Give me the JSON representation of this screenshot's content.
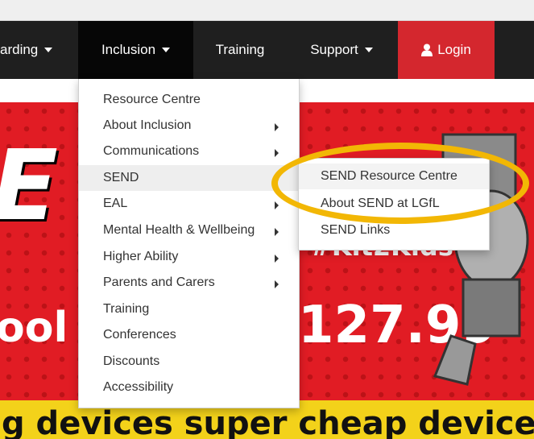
{
  "nav": {
    "safeguarding_label": "arding",
    "inclusion_label": "Inclusion",
    "training_label": "Training",
    "support_label": "Support",
    "login_label": "Login",
    "login_color": "#d4272e"
  },
  "dropdown": {
    "items": [
      {
        "label": "Resource Centre",
        "has_submenu": false
      },
      {
        "label": "About Inclusion",
        "has_submenu": true
      },
      {
        "label": "Communications",
        "has_submenu": true
      },
      {
        "label": "SEND",
        "has_submenu": true
      },
      {
        "label": "EAL",
        "has_submenu": true
      },
      {
        "label": "Mental Health & Wellbeing",
        "has_submenu": true
      },
      {
        "label": "Higher Ability",
        "has_submenu": true
      },
      {
        "label": "Parents and Carers",
        "has_submenu": true
      },
      {
        "label": "Training",
        "has_submenu": false
      },
      {
        "label": "Conferences",
        "has_submenu": false
      },
      {
        "label": "Discounts",
        "has_submenu": false
      },
      {
        "label": "Accessibility",
        "has_submenu": false
      }
    ]
  },
  "submenu": {
    "items": [
      {
        "label": "SEND Resource Centre"
      },
      {
        "label": "About SEND at LGfL"
      },
      {
        "label": "SEND Links"
      }
    ]
  },
  "banner": {
    "hashtag": "#Kit2Kids",
    "price_left": "ool",
    "price": "127.99",
    "big_letters": "E L",
    "bottom_text": "g devices super cheap devices lo",
    "accent_color": "#e11c24",
    "stripe_color": "#f3d21a"
  },
  "annotation": {
    "ring_color": "#f2b705"
  }
}
